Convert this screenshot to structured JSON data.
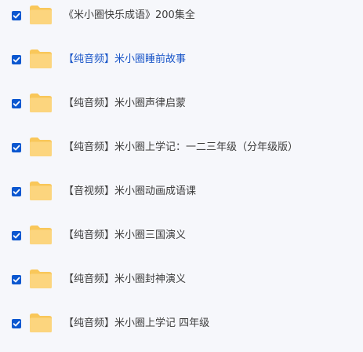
{
  "files": [
    {
      "name": "《米小圈快乐成语》200集全",
      "checked": true,
      "highlighted": false
    },
    {
      "name": "【纯音频】米小圈睡前故事",
      "checked": true,
      "highlighted": true
    },
    {
      "name": "【纯音频】米小圈声律启蒙",
      "checked": true,
      "highlighted": false
    },
    {
      "name": "【纯音频】米小圈上学记：一二三年级（分年级版）",
      "checked": true,
      "highlighted": false
    },
    {
      "name": "【音视频】米小圈动画成语课",
      "checked": true,
      "highlighted": false
    },
    {
      "name": "【纯音频】米小圈三国演义",
      "checked": true,
      "highlighted": false
    },
    {
      "name": "【纯音频】米小圈封神演义",
      "checked": true,
      "highlighted": false
    },
    {
      "name": "【纯音频】米小圈上学记 四年级",
      "checked": true,
      "highlighted": false
    }
  ],
  "icons": {
    "checkbox": "checkbox-checked-icon",
    "folder": "folder-icon"
  },
  "colors": {
    "checkbox": "#0b57d0",
    "folder": "#fcd57e",
    "highlight_text": "#1a56c8",
    "text": "#3d3d3d",
    "background": "#f6f7fb"
  }
}
